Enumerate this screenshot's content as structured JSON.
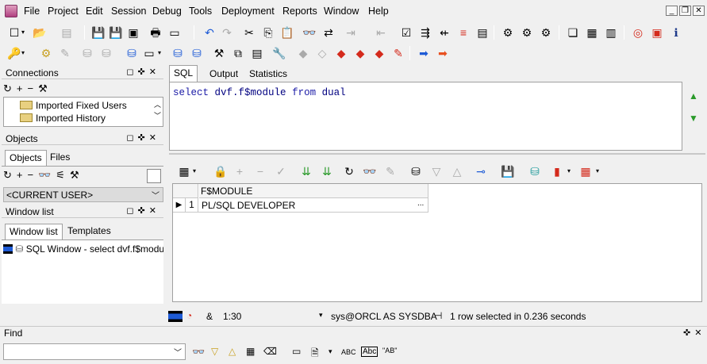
{
  "menu": {
    "items": [
      "File",
      "Project",
      "Edit",
      "Session",
      "Debug",
      "Tools",
      "Deployment",
      "Reports",
      "Window",
      "Help"
    ]
  },
  "connections": {
    "title": "Connections",
    "items": [
      "Imported Fixed Users",
      "Imported History"
    ]
  },
  "objects": {
    "title": "Objects",
    "tabs": [
      "Objects",
      "Files"
    ],
    "user_select": "<CURRENT USER>"
  },
  "window_list": {
    "title": "Window list",
    "tabs": [
      "Window list",
      "Templates"
    ],
    "items": [
      "SQL Window - select dvf.f$module from dual"
    ]
  },
  "editor": {
    "tabs": [
      "SQL",
      "Output",
      "Statistics"
    ],
    "sql_keyword1": "select",
    "sql_text": "dvf.f$module",
    "sql_keyword2": "from",
    "sql_table": "dual"
  },
  "grid": {
    "columns": [
      "F$MODULE"
    ],
    "rows": [
      {
        "num": "1",
        "value": "PL/SQL DEVELOPER"
      }
    ],
    "ellipsis": "..."
  },
  "status": {
    "amp": "&",
    "position": "1:30",
    "connection": "sys@ORCL AS SYSDBA",
    "message": "1 row selected in 0.236 seconds"
  },
  "find": {
    "title": "Find",
    "value": "",
    "abc1": "ABC",
    "abc2": "Abc",
    "abc3": "\"AB\""
  },
  "colors": {
    "keyword": "#1a1aa6",
    "identifier": "#000080",
    "accent_blue": "#1e5bd6",
    "accent_red": "#d42a1c"
  }
}
